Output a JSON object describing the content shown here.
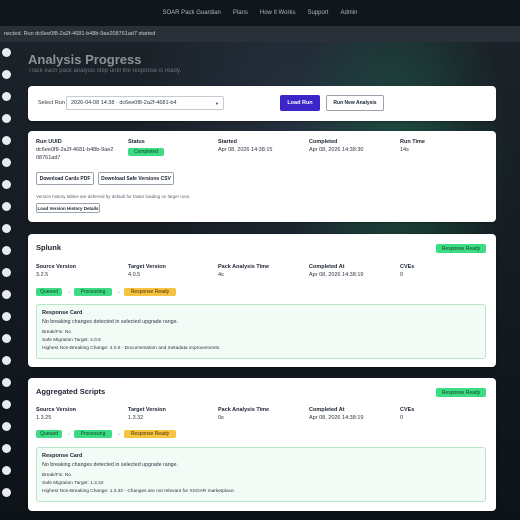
{
  "nav": {
    "items": [
      "SOAR Pack Guardian",
      "Plans",
      "How It Works",
      "Support",
      "Admin"
    ]
  },
  "banner": {
    "text": "nected. Run dc6ee0f8-2a2f-4681-b48b-9ae208761ad7 started"
  },
  "header": {
    "title": "Analysis Progress",
    "subtitle": "Track each pack analysis step until the response is ready."
  },
  "run_selector": {
    "label": "Select Run",
    "value": "2026-04-08 14:38 · dc6ee0f8-2a2f-4681-b4",
    "load_button": "Load Run",
    "new_button": "Run New Analysis"
  },
  "run_info": {
    "uuid_label": "Run UUID",
    "uuid_line1": "dc6ee0f8-2a2f-4681-b48b-9ae2",
    "uuid_line2": "08761ad7",
    "status_label": "Status",
    "status_value": "Completed",
    "started_label": "Started",
    "started_value": "Apr 08, 2026 14:38:15",
    "completed_label": "Completed",
    "completed_value": "Apr 08, 2026 14:38:30",
    "runtime_label": "Run Time",
    "runtime_value": "14s",
    "download_cards": "Download Cards PDF",
    "download_safe": "Download Safe Versions CSV",
    "history_note": "Version history tables are deferred by default for faster loading on larger runs.",
    "history_button": "Load Version History Details"
  },
  "packs": [
    {
      "name": "Splunk",
      "badge": "Response Ready",
      "source_label": "Source Version",
      "source_value": "3.2.5",
      "target_label": "Target Version",
      "target_value": "4.0.5",
      "time_label": "Pack Analysis Time",
      "time_value": "4s",
      "completed_label": "Completed At",
      "completed_value": "Apr 08, 2026 14:38:19",
      "cves_label": "CVEs",
      "cves_value": "0",
      "steps": [
        "Queued",
        "Processing",
        "Response Ready"
      ],
      "card_title": "Response Card",
      "card_summary": "No breaking changes detected in selected upgrade range.",
      "break_fix": "Break/Fix: No",
      "safe_target": "Safe Migration Target: 4.0.5",
      "highest_change": "Highest Non-Breaking Change: 4.0.5 - Documentation and metadata improvements."
    },
    {
      "name": "Aggregated Scripts",
      "badge": "Response Ready",
      "source_label": "Source Version",
      "source_value": "1.3.25",
      "target_label": "Target Version",
      "target_value": "1.3.32",
      "time_label": "Pack Analysis Time",
      "time_value": "0s",
      "completed_label": "Completed At",
      "completed_value": "Apr 08, 2026 14:38:19",
      "cves_label": "CVEs",
      "cves_value": "0",
      "steps": [
        "Queued",
        "Processing",
        "Response Ready"
      ],
      "card_title": "Response Card",
      "card_summary": "No breaking changes detected in selected upgrade range.",
      "break_fix": "Break/Fix: No",
      "safe_target": "Safe Migration Target: 1.3.32",
      "highest_change": "Highest Non-Breaking Change: 1.3.32 - Changes are not relevant for XSOAR marketplace."
    }
  ],
  "icons": {
    "arrow": "arrow-right-icon",
    "dropdown": "chevron-down-icon"
  },
  "colors": {
    "primary": "#3b25c9",
    "success": "#3ddc84",
    "warning": "#f5c242"
  }
}
